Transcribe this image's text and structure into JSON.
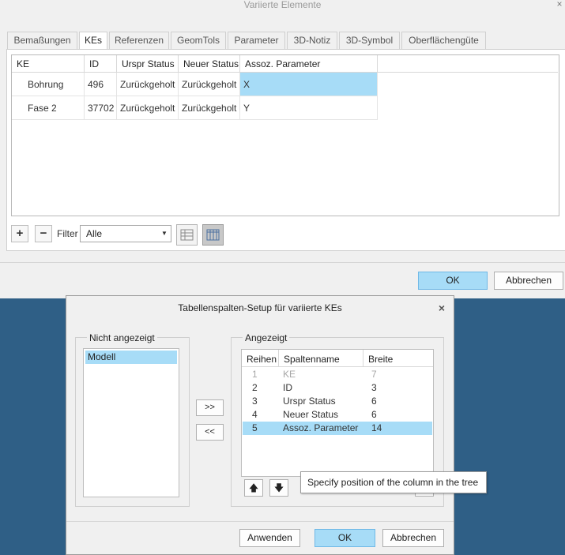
{
  "main_window": {
    "title": "Variierte Elemente",
    "close_glyph": "×",
    "tabs": [
      {
        "label": "Bemaßungen"
      },
      {
        "label": "KEs"
      },
      {
        "label": "Referenzen"
      },
      {
        "label": "GeomTols"
      },
      {
        "label": "Parameter"
      },
      {
        "label": "3D-Notiz"
      },
      {
        "label": "3D-Symbol"
      },
      {
        "label": "Oberflächengüte"
      }
    ],
    "active_tab": "KEs",
    "table": {
      "columns": [
        "KE",
        "ID",
        "Urspr Status",
        "Neuer Status",
        "Assoz. Parameter"
      ],
      "rows": [
        {
          "ke": "Bohrung",
          "id": "496",
          "orig_status": "Zurückgeholt",
          "new_status": "Zurückgeholt",
          "param": "X"
        },
        {
          "ke": "Fase 2",
          "id": "37702",
          "orig_status": "Zurückgeholt",
          "new_status": "Zurückgeholt",
          "param": "Y"
        }
      ]
    },
    "toolbar": {
      "add_glyph": "+",
      "remove_glyph": "−",
      "filter_label": "Filter",
      "filter_value": "Alle"
    },
    "buttons": {
      "ok": "OK",
      "cancel": "Abbrechen"
    }
  },
  "setup_dialog": {
    "title": "Tabellenspalten-Setup für variierte KEs",
    "close_glyph": "×",
    "not_shown": {
      "label": "Nicht angezeigt",
      "items": [
        "Modell"
      ]
    },
    "move_right": ">>",
    "move_left": "<<",
    "shown": {
      "label": "Angezeigt",
      "columns": [
        "Reihen",
        "Spaltenname",
        "Breite"
      ],
      "rows": [
        {
          "order": "1",
          "name": "KE",
          "width": "7"
        },
        {
          "order": "2",
          "name": "ID",
          "width": "3"
        },
        {
          "order": "3",
          "name": "Urspr Status",
          "width": "6"
        },
        {
          "order": "4",
          "name": "Neuer Status",
          "width": "6"
        },
        {
          "order": "5",
          "name": "Assoz. Parameter",
          "width": "14"
        }
      ]
    },
    "tooltip": "Specify position of the column in the tree",
    "buttons": {
      "apply": "Anwenden",
      "ok": "OK",
      "cancel": "Abbrechen"
    }
  },
  "colors": {
    "selection": "#a7dcf7",
    "backdrop": "#2f5f86",
    "window_bg": "#f0f0f0"
  }
}
